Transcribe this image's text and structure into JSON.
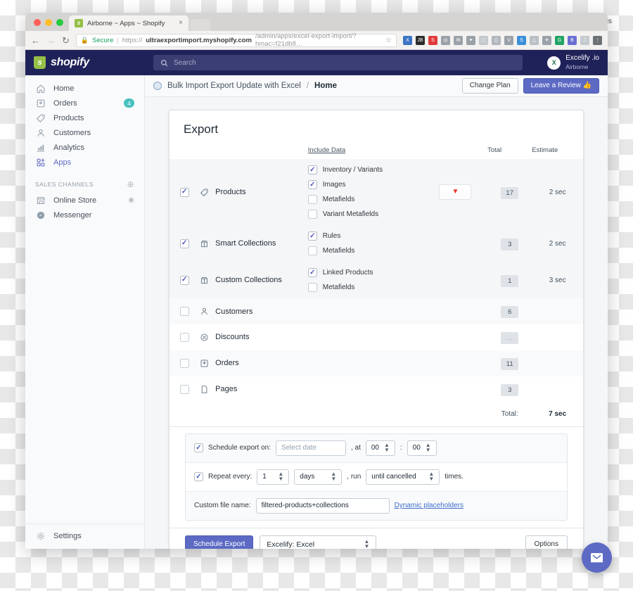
{
  "os": {
    "user_label": "Maris"
  },
  "browser": {
    "tab": {
      "title": "Airborne ~ Apps ~ Shopify",
      "favicon": "shopify-bag-icon",
      "close": "×"
    },
    "nav": {
      "back": "←",
      "forward": "→",
      "reload": "↻"
    },
    "omnibox": {
      "lock_icon": "lock-icon",
      "secure_label": "Secure",
      "scheme": "https://",
      "domain": "ultraexportimport.myshopify.com",
      "path": "/admin/apps/excel-export-import/?hmac=f21db8…",
      "star_icon": "star-icon"
    },
    "extensions": [
      {
        "name": "excel-extension-icon",
        "glyph": "X",
        "color": "#3b74c4"
      },
      {
        "name": "jetbrains-extension-icon",
        "glyph": "JB",
        "color": "#2b2b2b"
      },
      {
        "name": "record-extension-icon",
        "glyph": "S",
        "color": "#e03a3a"
      },
      {
        "name": "camera-extension-icon",
        "glyph": "◎",
        "color": "#9aa1a8"
      },
      {
        "name": "mail-extension-icon",
        "glyph": "✉",
        "color": "#9aa1a8"
      },
      {
        "name": "pin-extension-icon",
        "glyph": "✦",
        "color": "#9aa1a8"
      },
      {
        "name": "frame-extension-icon",
        "glyph": "▢",
        "color": "#c3c8cc"
      },
      {
        "name": "brackets-extension-icon",
        "glyph": "()",
        "color": "#b0b6bb"
      },
      {
        "name": "vimeo-extension-icon",
        "glyph": "V",
        "color": "#9aa1a8"
      },
      {
        "name": "svg-extension-icon",
        "glyph": "S",
        "color": "#3a8fd8"
      },
      {
        "name": "drive-extension-icon",
        "glyph": "△",
        "color": "#b9c0c6"
      },
      {
        "name": "runner-extension-icon",
        "glyph": "✈",
        "color": "#9aa1a8"
      },
      {
        "name": "grammarly-extension-icon",
        "glyph": "G",
        "color": "#21a465"
      },
      {
        "name": "bitwarden-extension-icon",
        "glyph": "B",
        "color": "#6a6fd4"
      },
      {
        "name": "info-extension-icon",
        "glyph": "ⓘ",
        "color": "#c3c8cc"
      },
      {
        "name": "menu-extension-icon",
        "glyph": "⋮",
        "color": "#6b7177"
      }
    ]
  },
  "shopify_header": {
    "logo_text": "shopify",
    "search": {
      "icon": "search-icon",
      "placeholder": "Search",
      "value": ""
    },
    "account": {
      "app_icon": "excel-app-icon",
      "name": "Excelify .io",
      "store": "Airborne"
    }
  },
  "sidebar": {
    "items": [
      {
        "label": "Home",
        "icon": "home-icon",
        "badge": "",
        "active": false
      },
      {
        "label": "Orders",
        "icon": "orders-inbox-icon",
        "badge": "4",
        "active": false
      },
      {
        "label": "Products",
        "icon": "tag-icon",
        "badge": "",
        "active": false
      },
      {
        "label": "Customers",
        "icon": "person-icon",
        "badge": "",
        "active": false
      },
      {
        "label": "Analytics",
        "icon": "bar-chart-icon",
        "badge": "",
        "active": false
      },
      {
        "label": "Apps",
        "icon": "apps-grid-icon",
        "badge": "",
        "active": true
      }
    ],
    "section": {
      "label": "Sales channels",
      "add_icon": "plus-circle-icon"
    },
    "channels": [
      {
        "label": "Online Store",
        "icon": "storefront-icon",
        "trailing_icon": "eye-icon"
      },
      {
        "label": "Messenger",
        "icon": "messenger-icon",
        "trailing_icon": ""
      }
    ],
    "settings": {
      "label": "Settings",
      "icon": "gear-icon"
    }
  },
  "page_header": {
    "app_icon": "app-circle-icon",
    "app_name": "Bulk Import Export Update with Excel",
    "separator": "/",
    "current": "Home",
    "change_plan_label": "Change Plan",
    "review_label": "Leave a Review 👍"
  },
  "export_card": {
    "title": "Export",
    "columns": {
      "include_data": "Include Data",
      "total": "Total",
      "estimate": "Estimate"
    },
    "rows": [
      {
        "name": "Products",
        "icon": "tag-icon",
        "selected": true,
        "include": [
          {
            "label": "Inventory / Variants",
            "checked": true
          },
          {
            "label": "Images",
            "checked": true
          },
          {
            "label": "Metafields",
            "checked": false
          },
          {
            "label": "Variant Metafields",
            "checked": false
          }
        ],
        "filter_icon": "filter-funnel-icon",
        "has_filter": true,
        "total": "17",
        "estimate": "2 sec"
      },
      {
        "name": "Smart Collections",
        "icon": "collection-icon",
        "selected": true,
        "include": [
          {
            "label": "Rules",
            "checked": true
          },
          {
            "label": "Metafields",
            "checked": false
          }
        ],
        "has_filter": false,
        "total": "3",
        "estimate": "2 sec"
      },
      {
        "name": "Custom Collections",
        "icon": "collection-icon",
        "selected": true,
        "include": [
          {
            "label": "Linked Products",
            "checked": true
          },
          {
            "label": "Metafields",
            "checked": false
          }
        ],
        "has_filter": false,
        "total": "1",
        "estimate": "3 sec"
      },
      {
        "name": "Customers",
        "icon": "person-icon",
        "selected": false,
        "include": [],
        "has_filter": false,
        "total": "6",
        "estimate": ""
      },
      {
        "name": "Discounts",
        "icon": "discount-icon",
        "selected": false,
        "include": [],
        "has_filter": false,
        "total": "...",
        "estimate": ""
      },
      {
        "name": "Orders",
        "icon": "orders-inbox-icon",
        "selected": false,
        "include": [],
        "has_filter": false,
        "total": "11",
        "estimate": ""
      },
      {
        "name": "Pages",
        "icon": "page-icon",
        "selected": false,
        "include": [],
        "has_filter": false,
        "total": "3",
        "estimate": ""
      }
    ],
    "total_row": {
      "label": "Total:",
      "value": "7 sec"
    },
    "schedule": {
      "checked": true,
      "label": "Schedule export on:",
      "date_placeholder": "Select date",
      "date_value": "",
      "at_label": ", at",
      "hour": "00",
      "time_sep": ":",
      "minute": "00"
    },
    "repeat": {
      "checked": true,
      "label": "Repeat every:",
      "interval": "1",
      "unit": "days",
      "run_label": ", run",
      "run_count": "until cancelled",
      "times_label": "times."
    },
    "filename": {
      "label": "Custom file name:",
      "value": "filtered-products+collections",
      "link": "Dynamic placeholders"
    },
    "footer": {
      "schedule_button": "Schedule Export",
      "format": "Excelify: Excel",
      "options_button": "Options"
    }
  },
  "chat": {
    "icon": "envelope-chat-icon"
  },
  "colors": {
    "shopify_navy": "#1f2259",
    "indigo": "#5c6ac4",
    "teal_badge": "#47c1bf",
    "filter_red": "#e8342b",
    "link_blue": "#3f6ecb",
    "secure_green": "#0f9d58"
  }
}
